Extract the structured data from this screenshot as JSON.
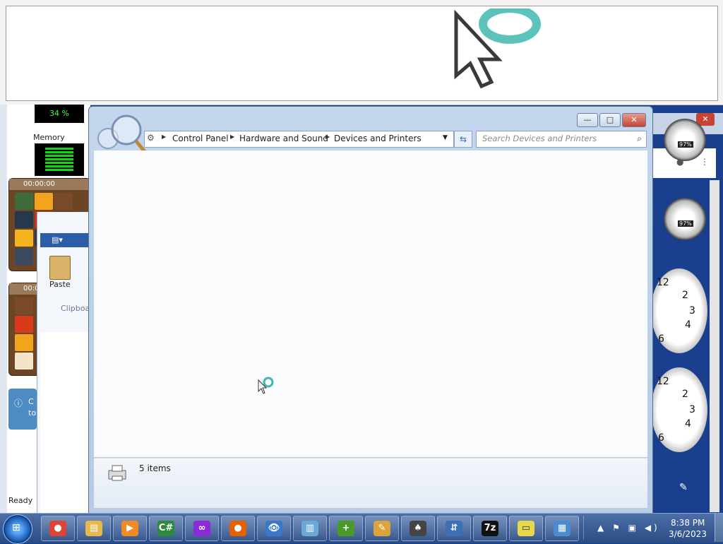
{
  "magnifier": {
    "title": ""
  },
  "background_apps": {
    "cpu_meter": {
      "value": "34 %"
    },
    "memory_label": "Memory",
    "clock_timer_1": "00:00:00",
    "clock_timer_2": "00:0",
    "paint": {
      "paste_label": "Paste",
      "clipboard_label": "Clipboa",
      "status": "Ready"
    },
    "info_balloon": {
      "line1": "C",
      "line2": "to"
    }
  },
  "right_gadgets": {
    "gauge_pct_1": "97%",
    "gauge_pct_2": "97%",
    "clock_numbers": [
      "12",
      "2",
      "3",
      "4",
      "6"
    ]
  },
  "explorer": {
    "breadcrumb": [
      {
        "label": "Control Panel"
      },
      {
        "label": "Hardware and Sound"
      },
      {
        "label": "Devices and Printers"
      }
    ],
    "search_placeholder": "Search Devices and Printers",
    "items_count": "5 items",
    "controls": {
      "minimize": "—",
      "maximize": "□",
      "close": "✕"
    }
  },
  "taskbar": {
    "buttons": [
      {
        "name": "chrome",
        "glyph": "●",
        "color": "#db4437"
      },
      {
        "name": "explorer",
        "glyph": "▤",
        "color": "#e8b94a"
      },
      {
        "name": "media-player",
        "glyph": "▶",
        "color": "#f08a24"
      },
      {
        "name": "csharp",
        "glyph": "C#",
        "color": "#2c8a3c"
      },
      {
        "name": "infinity",
        "glyph": "∞",
        "color": "#8a2bd6"
      },
      {
        "name": "firefox",
        "glyph": "●",
        "color": "#e66000"
      },
      {
        "name": "eyes",
        "glyph": "👁",
        "color": "#3a78c9"
      },
      {
        "name": "notepad",
        "glyph": "▥",
        "color": "#6aa9d8"
      },
      {
        "name": "notepad-plus-plus",
        "glyph": "+",
        "color": "#4a9a2a"
      },
      {
        "name": "paint",
        "glyph": "✎",
        "color": "#d9a43c"
      },
      {
        "name": "solitaire",
        "glyph": "♠",
        "color": "#444444"
      },
      {
        "name": "network-lock",
        "glyph": "⇵",
        "color": "#3b6fb6"
      },
      {
        "name": "7zip",
        "glyph": "7z",
        "color": "#111111"
      },
      {
        "name": "sticky-notes",
        "glyph": "▭",
        "color": "#e6d84a"
      },
      {
        "name": "control-panel",
        "glyph": "▦",
        "color": "#4b8bd1"
      }
    ],
    "clock_time": "8:38 PM",
    "clock_date": "3/6/2023"
  },
  "colors": {
    "accent": "#2c5da8",
    "taskbar": "#2a4b84",
    "close": "#c54534"
  }
}
